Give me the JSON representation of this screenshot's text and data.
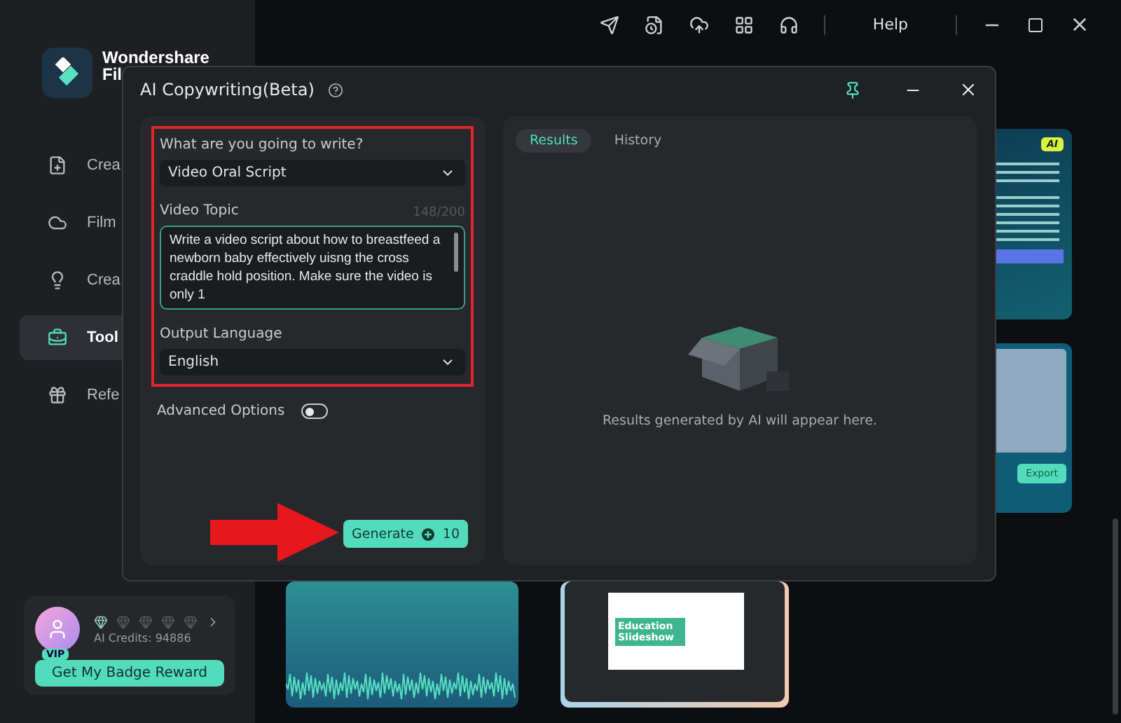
{
  "app_bar": {
    "help": "Help"
  },
  "sidebar": {
    "brand": [
      "Wondershare",
      "Fil"
    ],
    "items": [
      {
        "label": "Crea",
        "selected": false
      },
      {
        "label": "Film",
        "selected": false
      },
      {
        "label": "Crea",
        "selected": false
      },
      {
        "label": "Tool",
        "selected": true
      },
      {
        "label": "Refe",
        "selected": false
      }
    ],
    "account": {
      "vip": "VIP",
      "credits": "AI Credits: 94886",
      "button": "Get My Badge Reward"
    }
  },
  "templates": {
    "ai_badge": "AI",
    "export": "Export",
    "slideshow_title": "Education Slideshow"
  },
  "dialog": {
    "title": "AI Copywriting(Beta)",
    "form": {
      "type_label": "What are you going to write?",
      "type_value": "Video Oral Script",
      "topic_label": "Video Topic",
      "topic_count": "148/200",
      "topic_value": "Write a video script about how to breastfeed a newborn baby effectively uisng the cross craddle hold position. Make sure the video is only 1",
      "language_label": "Output Language",
      "language_value": "English",
      "advanced_label": "Advanced Options",
      "advanced_on": false,
      "generate": "Generate",
      "cost": "10"
    },
    "tabs": [
      {
        "label": "Results",
        "selected": true
      },
      {
        "label": "History",
        "selected": false
      }
    ],
    "empty_text": "Results generated by AI will appear here."
  }
}
